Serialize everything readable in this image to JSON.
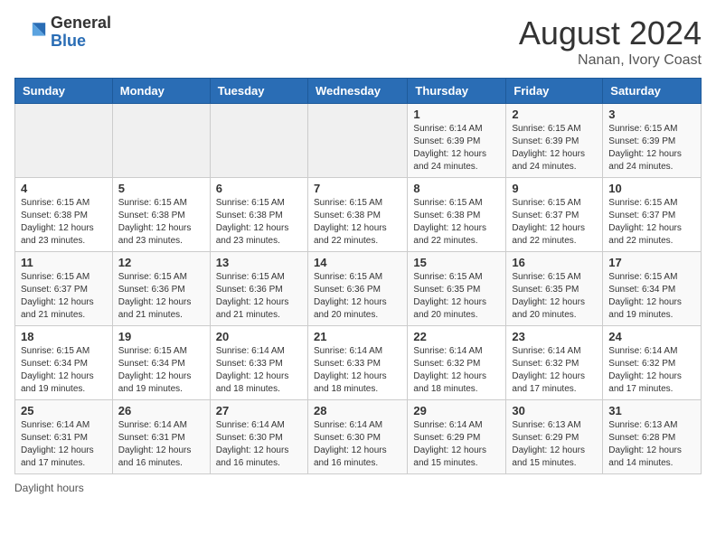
{
  "header": {
    "logo_general": "General",
    "logo_blue": "Blue",
    "month_year": "August 2024",
    "location": "Nanan, Ivory Coast"
  },
  "calendar": {
    "days_of_week": [
      "Sunday",
      "Monday",
      "Tuesday",
      "Wednesday",
      "Thursday",
      "Friday",
      "Saturday"
    ],
    "weeks": [
      [
        {
          "day": "",
          "info": ""
        },
        {
          "day": "",
          "info": ""
        },
        {
          "day": "",
          "info": ""
        },
        {
          "day": "",
          "info": ""
        },
        {
          "day": "1",
          "info": "Sunrise: 6:14 AM\nSunset: 6:39 PM\nDaylight: 12 hours\nand 24 minutes."
        },
        {
          "day": "2",
          "info": "Sunrise: 6:15 AM\nSunset: 6:39 PM\nDaylight: 12 hours\nand 24 minutes."
        },
        {
          "day": "3",
          "info": "Sunrise: 6:15 AM\nSunset: 6:39 PM\nDaylight: 12 hours\nand 24 minutes."
        }
      ],
      [
        {
          "day": "4",
          "info": "Sunrise: 6:15 AM\nSunset: 6:38 PM\nDaylight: 12 hours\nand 23 minutes."
        },
        {
          "day": "5",
          "info": "Sunrise: 6:15 AM\nSunset: 6:38 PM\nDaylight: 12 hours\nand 23 minutes."
        },
        {
          "day": "6",
          "info": "Sunrise: 6:15 AM\nSunset: 6:38 PM\nDaylight: 12 hours\nand 23 minutes."
        },
        {
          "day": "7",
          "info": "Sunrise: 6:15 AM\nSunset: 6:38 PM\nDaylight: 12 hours\nand 22 minutes."
        },
        {
          "day": "8",
          "info": "Sunrise: 6:15 AM\nSunset: 6:38 PM\nDaylight: 12 hours\nand 22 minutes."
        },
        {
          "day": "9",
          "info": "Sunrise: 6:15 AM\nSunset: 6:37 PM\nDaylight: 12 hours\nand 22 minutes."
        },
        {
          "day": "10",
          "info": "Sunrise: 6:15 AM\nSunset: 6:37 PM\nDaylight: 12 hours\nand 22 minutes."
        }
      ],
      [
        {
          "day": "11",
          "info": "Sunrise: 6:15 AM\nSunset: 6:37 PM\nDaylight: 12 hours\nand 21 minutes."
        },
        {
          "day": "12",
          "info": "Sunrise: 6:15 AM\nSunset: 6:36 PM\nDaylight: 12 hours\nand 21 minutes."
        },
        {
          "day": "13",
          "info": "Sunrise: 6:15 AM\nSunset: 6:36 PM\nDaylight: 12 hours\nand 21 minutes."
        },
        {
          "day": "14",
          "info": "Sunrise: 6:15 AM\nSunset: 6:36 PM\nDaylight: 12 hours\nand 20 minutes."
        },
        {
          "day": "15",
          "info": "Sunrise: 6:15 AM\nSunset: 6:35 PM\nDaylight: 12 hours\nand 20 minutes."
        },
        {
          "day": "16",
          "info": "Sunrise: 6:15 AM\nSunset: 6:35 PM\nDaylight: 12 hours\nand 20 minutes."
        },
        {
          "day": "17",
          "info": "Sunrise: 6:15 AM\nSunset: 6:34 PM\nDaylight: 12 hours\nand 19 minutes."
        }
      ],
      [
        {
          "day": "18",
          "info": "Sunrise: 6:15 AM\nSunset: 6:34 PM\nDaylight: 12 hours\nand 19 minutes."
        },
        {
          "day": "19",
          "info": "Sunrise: 6:15 AM\nSunset: 6:34 PM\nDaylight: 12 hours\nand 19 minutes."
        },
        {
          "day": "20",
          "info": "Sunrise: 6:14 AM\nSunset: 6:33 PM\nDaylight: 12 hours\nand 18 minutes."
        },
        {
          "day": "21",
          "info": "Sunrise: 6:14 AM\nSunset: 6:33 PM\nDaylight: 12 hours\nand 18 minutes."
        },
        {
          "day": "22",
          "info": "Sunrise: 6:14 AM\nSunset: 6:32 PM\nDaylight: 12 hours\nand 18 minutes."
        },
        {
          "day": "23",
          "info": "Sunrise: 6:14 AM\nSunset: 6:32 PM\nDaylight: 12 hours\nand 17 minutes."
        },
        {
          "day": "24",
          "info": "Sunrise: 6:14 AM\nSunset: 6:32 PM\nDaylight: 12 hours\nand 17 minutes."
        }
      ],
      [
        {
          "day": "25",
          "info": "Sunrise: 6:14 AM\nSunset: 6:31 PM\nDaylight: 12 hours\nand 17 minutes."
        },
        {
          "day": "26",
          "info": "Sunrise: 6:14 AM\nSunset: 6:31 PM\nDaylight: 12 hours\nand 16 minutes."
        },
        {
          "day": "27",
          "info": "Sunrise: 6:14 AM\nSunset: 6:30 PM\nDaylight: 12 hours\nand 16 minutes."
        },
        {
          "day": "28",
          "info": "Sunrise: 6:14 AM\nSunset: 6:30 PM\nDaylight: 12 hours\nand 16 minutes."
        },
        {
          "day": "29",
          "info": "Sunrise: 6:14 AM\nSunset: 6:29 PM\nDaylight: 12 hours\nand 15 minutes."
        },
        {
          "day": "30",
          "info": "Sunrise: 6:13 AM\nSunset: 6:29 PM\nDaylight: 12 hours\nand 15 minutes."
        },
        {
          "day": "31",
          "info": "Sunrise: 6:13 AM\nSunset: 6:28 PM\nDaylight: 12 hours\nand 14 minutes."
        }
      ]
    ]
  },
  "footer": {
    "note": "Daylight hours"
  }
}
